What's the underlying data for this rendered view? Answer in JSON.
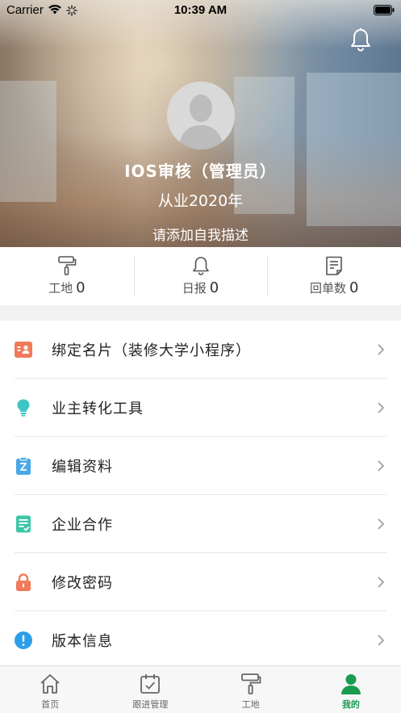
{
  "status_bar": {
    "carrier": "Carrier",
    "time": "10:39 AM"
  },
  "profile": {
    "name": "IOS审核（管理员）",
    "years": "从业2020年",
    "description": "请添加自我描述"
  },
  "stats": [
    {
      "label": "工地",
      "value": "0",
      "icon": "paint-roller-icon"
    },
    {
      "label": "日报",
      "value": "0",
      "icon": "bell-icon"
    },
    {
      "label": "回单数",
      "value": "0",
      "icon": "document-icon"
    }
  ],
  "menu": [
    {
      "label": "绑定名片（装修大学小程序）",
      "icon": "contact-card-icon",
      "color": "#f07a5a"
    },
    {
      "label": "业主转化工具",
      "icon": "lightbulb-icon",
      "color": "#3ec6c6"
    },
    {
      "label": "编辑资料",
      "icon": "edit-clipboard-icon",
      "color": "#4aa8e8"
    },
    {
      "label": "企业合作",
      "icon": "checklist-icon",
      "color": "#3ec6a8"
    },
    {
      "label": "修改密码",
      "icon": "lock-icon",
      "color": "#f07a5a"
    },
    {
      "label": "版本信息",
      "icon": "info-icon",
      "color": "#2f9ee8"
    }
  ],
  "tabs": [
    {
      "label": "首页",
      "icon": "home-icon"
    },
    {
      "label": "跟进管理",
      "icon": "calendar-check-icon"
    },
    {
      "label": "工地",
      "icon": "paint-roller-icon"
    },
    {
      "label": "我的",
      "icon": "person-icon"
    }
  ],
  "colors": {
    "accent": "#1a9b4f",
    "tab_inactive": "#666666"
  }
}
